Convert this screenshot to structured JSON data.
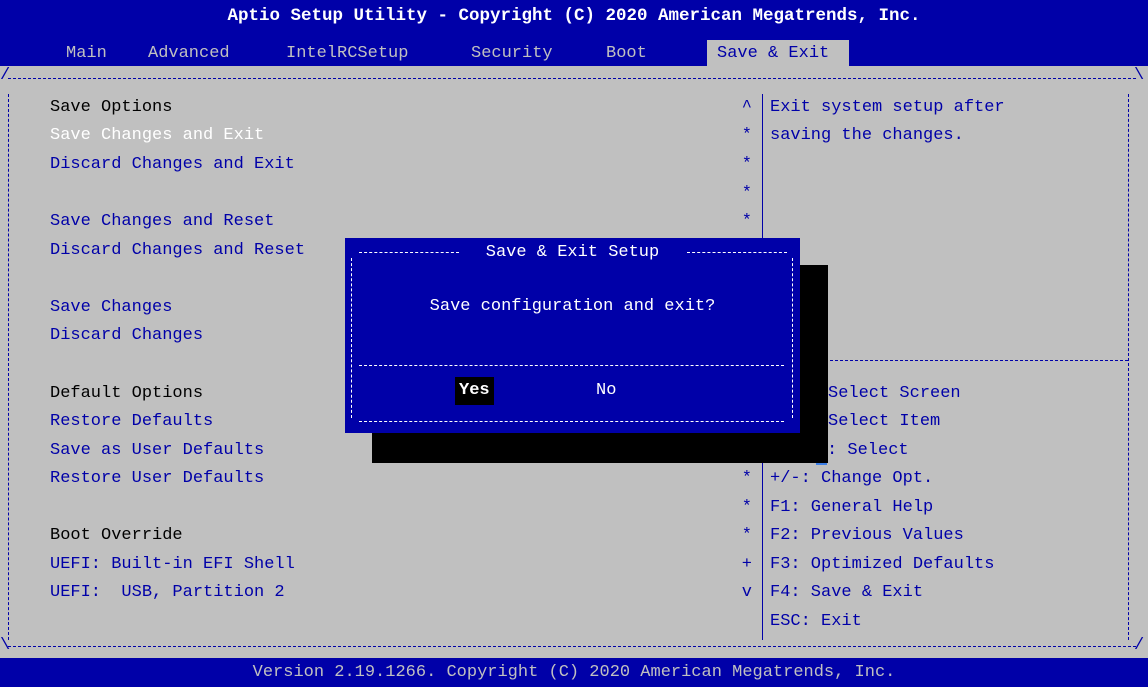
{
  "header": {
    "title": "Aptio Setup Utility - Copyright (C) 2020 American Megatrends, Inc."
  },
  "menu": {
    "tabs": [
      {
        "label": "Main"
      },
      {
        "label": "Advanced"
      },
      {
        "label": "IntelRCSetup"
      },
      {
        "label": "Security"
      },
      {
        "label": "Boot"
      },
      {
        "label": "Save & Exit",
        "active": true
      }
    ]
  },
  "left_panel": {
    "rows": [
      {
        "text": "Save Options",
        "kind": "heading"
      },
      {
        "text": "Save Changes and Exit",
        "kind": "item",
        "highlighted": true
      },
      {
        "text": "Discard Changes and Exit",
        "kind": "item"
      },
      {
        "text": "",
        "kind": "blank"
      },
      {
        "text": "Save Changes and Reset",
        "kind": "item"
      },
      {
        "text": "Discard Changes and Reset",
        "kind": "item"
      },
      {
        "text": "",
        "kind": "blank"
      },
      {
        "text": "Save Changes",
        "kind": "item"
      },
      {
        "text": "Discard Changes",
        "kind": "item"
      },
      {
        "text": "",
        "kind": "blank"
      },
      {
        "text": "Default Options",
        "kind": "heading"
      },
      {
        "text": "Restore Defaults",
        "kind": "item"
      },
      {
        "text": "Save as User Defaults",
        "kind": "item"
      },
      {
        "text": "Restore User Defaults",
        "kind": "item"
      },
      {
        "text": "",
        "kind": "blank"
      },
      {
        "text": "Boot Override",
        "kind": "heading"
      },
      {
        "text": "UEFI: Built-in EFI Shell",
        "kind": "item"
      },
      {
        "text": "UEFI:  USB, Partition 2",
        "kind": "item"
      }
    ]
  },
  "scroll_markers": [
    "^",
    "*",
    "*",
    "*",
    "*",
    "",
    "",
    "",
    "",
    "",
    "",
    "",
    "",
    "*",
    "*",
    "*",
    "+",
    "v"
  ],
  "help_text": [
    "Exit system setup after",
    "saving the changes."
  ],
  "key_help": [
    "Select Screen",
    "Select Item",
    ": Select",
    "+/-: Change Opt.",
    "F1: General Help",
    "F2: Previous Values",
    "F3: Optimized Defaults",
    "F4: Save & Exit",
    "ESC: Exit"
  ],
  "key_help_prefix": {
    "enter_partial": "r"
  },
  "dialog": {
    "title": "Save & Exit Setup",
    "message": "Save configuration and exit?",
    "yes_label": "Yes",
    "no_label": "No"
  },
  "footer": {
    "text": "Version 2.19.1266. Copyright (C) 2020 American Megatrends, Inc."
  },
  "colors": {
    "bios_blue": "#0000A8",
    "bios_gray": "#C0C0C0",
    "bios_white": "#FFFFFF",
    "cursor_blue": "#3D7FE6"
  }
}
